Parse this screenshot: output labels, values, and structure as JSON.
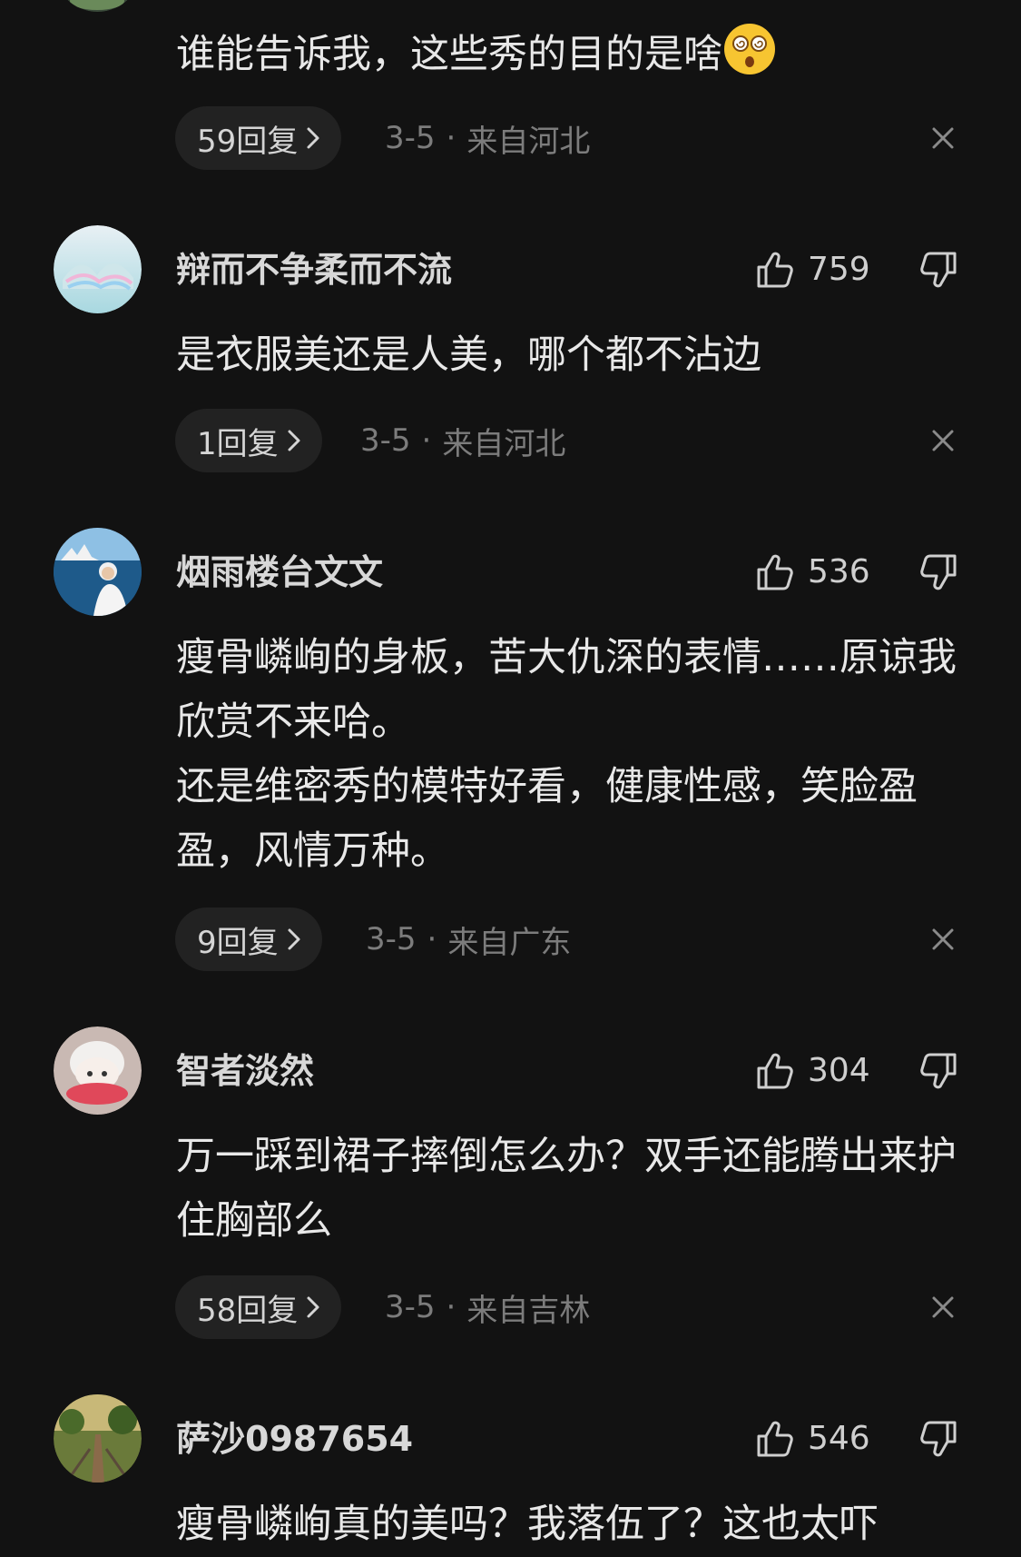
{
  "colors": {
    "background": "#121212",
    "pill": "#222222",
    "text_primary": "#e8e8e8",
    "text_muted": "#7c7c7c"
  },
  "comments": [
    {
      "text": "谁能告诉我，这些秀的目的是啥",
      "emoji": "dizzy-face-emoji",
      "reply_label": "59回复",
      "date": "3-5",
      "separator": "·",
      "location": "来自河北"
    },
    {
      "username": "辩而不争柔而不流",
      "likes": "759",
      "text": "是衣服美还是人美，哪个都不沾边",
      "reply_label": "1回复",
      "date": "3-5",
      "separator": "·",
      "location": "来自河北"
    },
    {
      "username": "烟雨楼台文文",
      "likes": "536",
      "text": "瘦骨嶙峋的身板，苦大仇深的表情……原谅我欣赏不来哈。\n还是维密秀的模特好看，健康性感，笑脸盈盈，风情万种。",
      "reply_label": "9回复",
      "date": "3-5",
      "separator": "·",
      "location": "来自广东"
    },
    {
      "username": "智者淡然",
      "likes": "304",
      "text": "万一踩到裙子摔倒怎么办？双手还能腾出来护住胸部么",
      "reply_label": "58回复",
      "date": "3-5",
      "separator": "·",
      "location": "来自吉林"
    },
    {
      "username": "萨沙0987654",
      "likes": "546",
      "text": "瘦骨嶙峋真的美吗？我落伍了？这也太吓"
    }
  ]
}
